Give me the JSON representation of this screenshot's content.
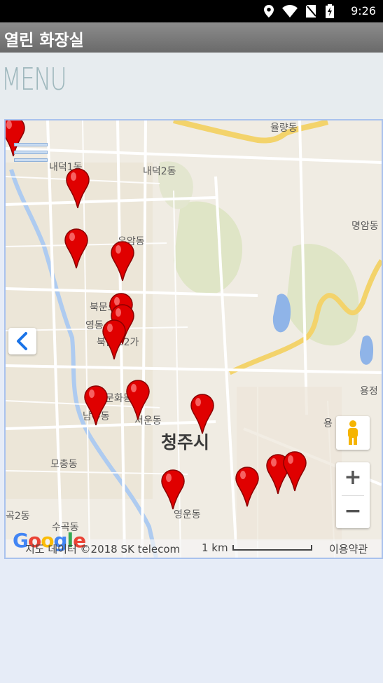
{
  "status_bar": {
    "time": "9:26",
    "icons": [
      "location-icon",
      "wifi-icon",
      "no-sim-icon",
      "battery-charging-icon"
    ]
  },
  "app_bar": {
    "title": "열린 화장실"
  },
  "menu": {
    "label": "MENU"
  },
  "map": {
    "labels": {
      "naedeok1": "내덕1동",
      "naedeok2": "내덕2동",
      "yulyang": "율량동",
      "myeongam": "명암동",
      "uam": "우암동",
      "bukmun": "북문로1가",
      "yeongdong": "영동",
      "bukmun2": "북문로2가",
      "yongjeong": "용정",
      "munhwa": "문화동",
      "namju": "남주동",
      "seoun": "서운동",
      "city": "청주시",
      "yong": "용",
      "mochung": "모충동",
      "gok": "곡2동",
      "sugok": "수곡동",
      "yeongun": "영운동"
    },
    "google_logo": "Google",
    "attribution": "지도 데이터 ©2018 SK telecom",
    "scale": "1 km",
    "terms": "이용약관",
    "zoom_in": "+",
    "zoom_out": "−",
    "marker_color": "#e00000",
    "marker_count": 16
  }
}
